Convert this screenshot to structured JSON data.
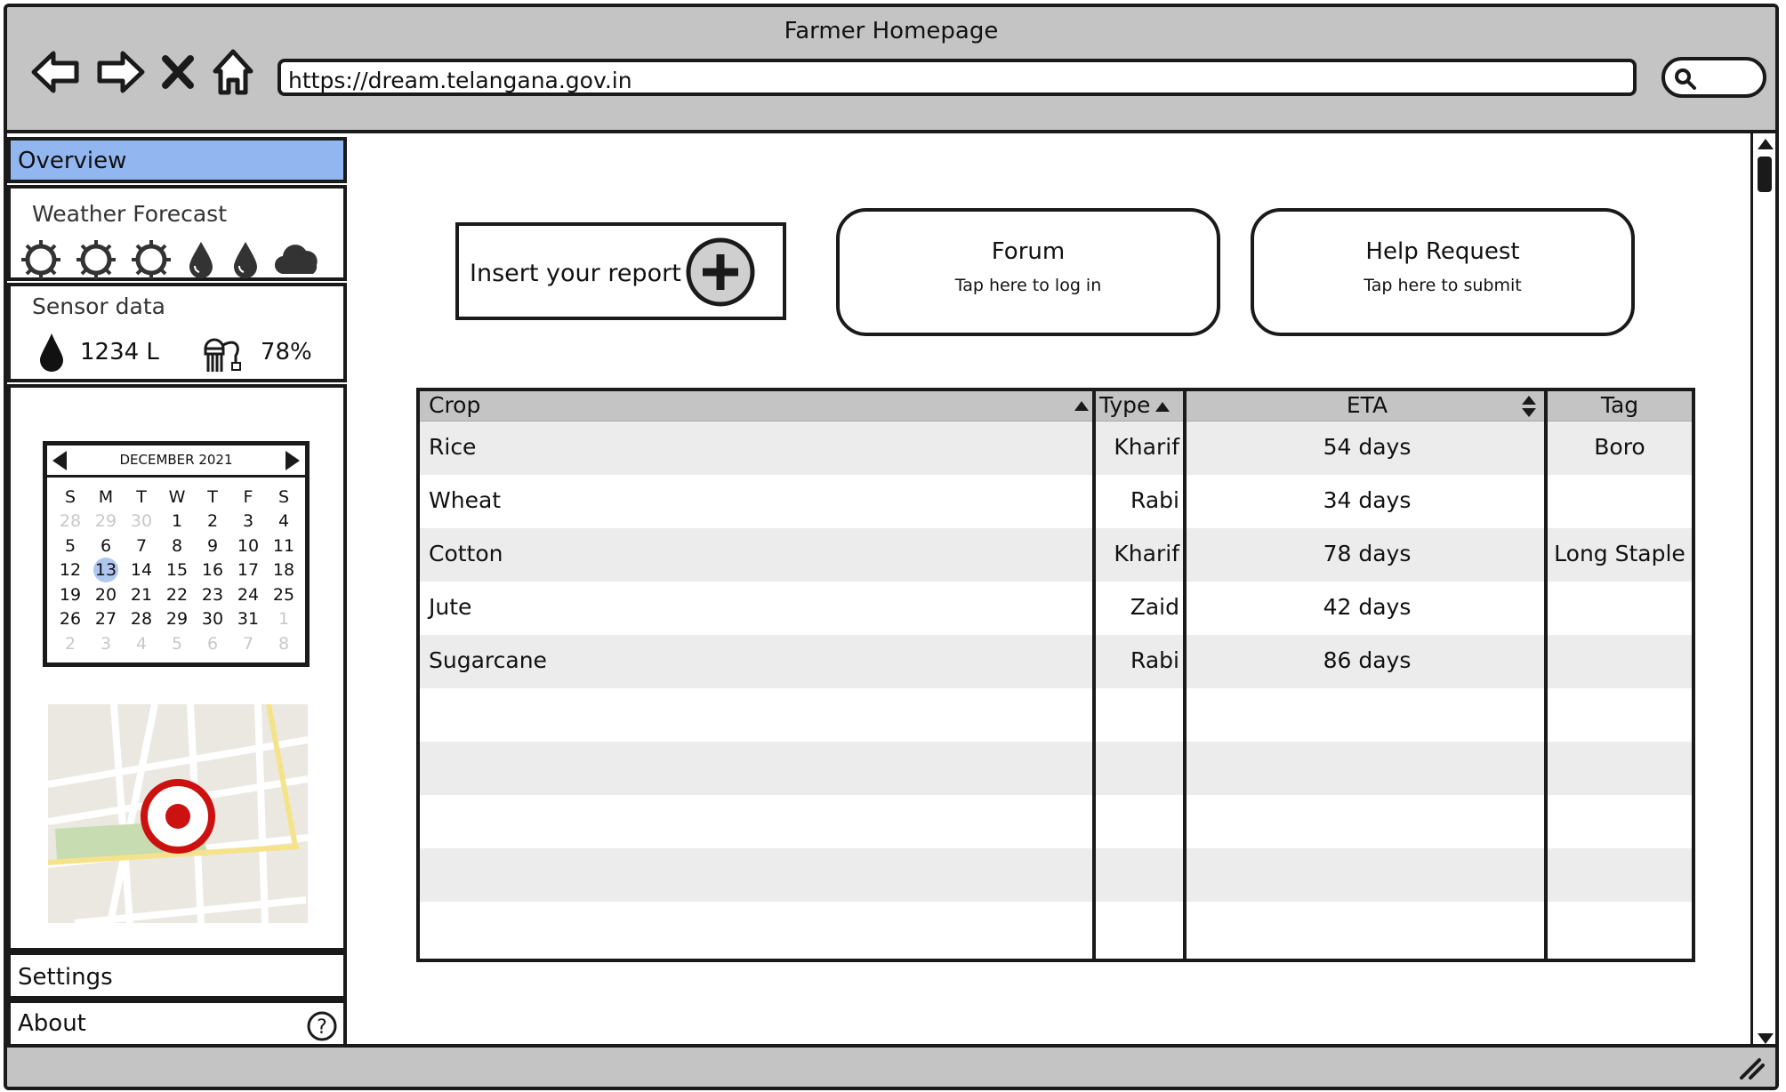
{
  "window": {
    "title": "Farmer Homepage",
    "url": "https://dream.telangana.gov.in"
  },
  "sidebar": {
    "overview": "Overview",
    "weather": {
      "label": "Weather Forecast",
      "icons": [
        "sun-icon",
        "sun-icon",
        "sun-icon",
        "raindrop-icon",
        "raindrop-icon",
        "cloud-icon"
      ]
    },
    "sensor": {
      "label": "Sensor data",
      "water": "1234 L",
      "moisture": "78%"
    },
    "calendar": {
      "month": "DECEMBER 2021",
      "days": [
        "S",
        "M",
        "T",
        "W",
        "T",
        "F",
        "S"
      ],
      "weeks": [
        [
          "28",
          "29",
          "30",
          "1",
          "2",
          "3",
          "4"
        ],
        [
          "5",
          "6",
          "7",
          "8",
          "9",
          "10",
          "11"
        ],
        [
          "12",
          "13",
          "14",
          "15",
          "16",
          "17",
          "18"
        ],
        [
          "19",
          "20",
          "21",
          "22",
          "23",
          "24",
          "25"
        ],
        [
          "26",
          "27",
          "28",
          "29",
          "30",
          "31",
          "1"
        ],
        [
          "2",
          "3",
          "4",
          "5",
          "6",
          "7",
          "8"
        ]
      ],
      "selected": "13"
    },
    "settings": "Settings",
    "about": "About"
  },
  "actions": {
    "report": "Insert your report",
    "forum": {
      "title": "Forum",
      "sub": "Tap here to log in"
    },
    "help": {
      "title": "Help Request",
      "sub": "Tap here to submit"
    }
  },
  "table": {
    "columns": [
      "Crop",
      "Type",
      "ETA",
      "Tag"
    ],
    "rows": [
      [
        "Rice",
        "Kharif",
        "54 days",
        "Boro"
      ],
      [
        "Wheat",
        "Rabi",
        "34 days",
        ""
      ],
      [
        "Cotton",
        "Kharif",
        "78 days",
        "Long Staple"
      ],
      [
        "Jute",
        "Zaid",
        "42 days",
        ""
      ],
      [
        "Sugarcane",
        "Rabi",
        "86 days",
        ""
      ]
    ]
  },
  "colors": {
    "selected_nav": "#92b7f0",
    "chrome": "#c4c4c4",
    "row_alt": "#ececec",
    "map_pin": "#cc1111"
  }
}
